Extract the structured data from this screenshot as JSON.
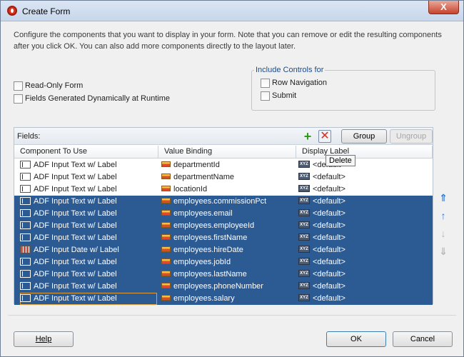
{
  "window": {
    "title": "Create Form",
    "close_label": "X"
  },
  "description": "Configure the components that you want to display in your form. Note that you can remove or edit the resulting components after you click OK. You can also add more components directly to the layout later.",
  "options": {
    "read_only_form": {
      "label": "Read-Only Form",
      "checked": false
    },
    "fields_dynamic": {
      "label": "Fields Generated Dynamically at Runtime",
      "checked": false
    }
  },
  "include_controls": {
    "legend": "Include Controls for",
    "row_navigation": {
      "label": "Row Navigation",
      "checked": false
    },
    "submit": {
      "label": "Submit",
      "checked": false
    }
  },
  "fields": {
    "label": "Fields:",
    "add_icon": "plus-icon",
    "delete_icon": "delete-icon",
    "group_label": "Group",
    "ungroup_label": "Ungroup",
    "columns": [
      "Component To Use",
      "Value Binding",
      "Display Label"
    ],
    "tooltip": "Delete",
    "rows": [
      {
        "component": "ADF Input Text w/ Label",
        "binding": "departmentId",
        "label": "<default>",
        "selected": false,
        "icon": "input-text-icon"
      },
      {
        "component": "ADF Input Text w/ Label",
        "binding": "departmentName",
        "label": "<default>",
        "selected": false,
        "icon": "input-text-icon"
      },
      {
        "component": "ADF Input Text w/ Label",
        "binding": "locationId",
        "label": "<default>",
        "selected": false,
        "icon": "input-text-icon"
      },
      {
        "component": "ADF Input Text w/ Label",
        "binding": "employees.commissionPct",
        "label": "<default>",
        "selected": true,
        "icon": "input-text-icon"
      },
      {
        "component": "ADF Input Text w/ Label",
        "binding": "employees.email",
        "label": "<default>",
        "selected": true,
        "icon": "input-text-icon"
      },
      {
        "component": "ADF Input Text w/ Label",
        "binding": "employees.employeeId",
        "label": "<default>",
        "selected": true,
        "icon": "input-text-icon"
      },
      {
        "component": "ADF Input Text w/ Label",
        "binding": "employees.firstName",
        "label": "<default>",
        "selected": true,
        "icon": "input-text-icon"
      },
      {
        "component": "ADF Input Date w/ Label",
        "binding": "employees.hireDate",
        "label": "<default>",
        "selected": true,
        "icon": "input-date-icon"
      },
      {
        "component": "ADF Input Text w/ Label",
        "binding": "employees.jobId",
        "label": "<default>",
        "selected": true,
        "icon": "input-text-icon"
      },
      {
        "component": "ADF Input Text w/ Label",
        "binding": "employees.lastName",
        "label": "<default>",
        "selected": true,
        "icon": "input-text-icon"
      },
      {
        "component": "ADF Input Text w/ Label",
        "binding": "employees.phoneNumber",
        "label": "<default>",
        "selected": true,
        "icon": "input-text-icon"
      },
      {
        "component": "ADF Input Text w/ Label",
        "binding": "employees.salary",
        "label": "<default>",
        "selected": true,
        "icon": "input-text-icon"
      }
    ],
    "reorder_icons": [
      "move-top-icon",
      "move-up-icon",
      "move-down-icon",
      "move-bottom-icon"
    ]
  },
  "footer": {
    "help_label": "Help",
    "ok_label": "OK",
    "cancel_label": "Cancel"
  },
  "colors": {
    "selection": "#2c5a93",
    "accent": "#1b4b8a"
  }
}
